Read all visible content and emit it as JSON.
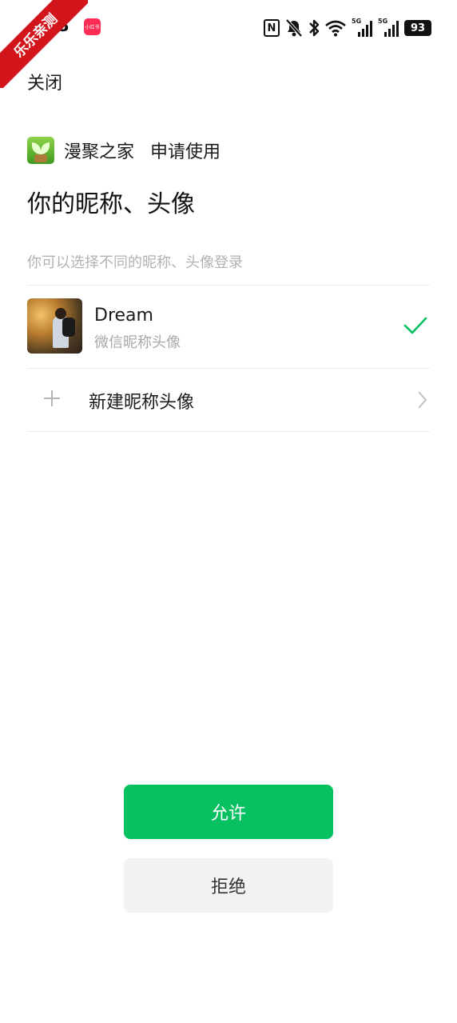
{
  "status_bar": {
    "time": "08",
    "app_badge": "小红书",
    "nfc": "N",
    "signal1_tag": "5G",
    "signal2_tag": "5G",
    "battery": "93"
  },
  "watermark": {
    "text": "乐乐亲测"
  },
  "header": {
    "close_label": "关闭",
    "app_name": "漫聚之家",
    "request_text": "申请使用",
    "title": "你的昵称、头像"
  },
  "hint": "你可以选择不同的昵称、头像登录",
  "profiles": [
    {
      "name": "Dream",
      "subtitle": "微信昵称头像",
      "selected": true
    }
  ],
  "new_profile_label": "新建昵称头像",
  "actions": {
    "allow_label": "允许",
    "deny_label": "拒绝"
  },
  "colors": {
    "accent": "#07c160",
    "deny_bg": "#f2f2f2",
    "hint": "#b2b2b2",
    "watermark": "#d2141b"
  },
  "icons": {
    "check": "check-icon",
    "plus": "plus-icon",
    "chevron": "chevron-right-icon"
  }
}
